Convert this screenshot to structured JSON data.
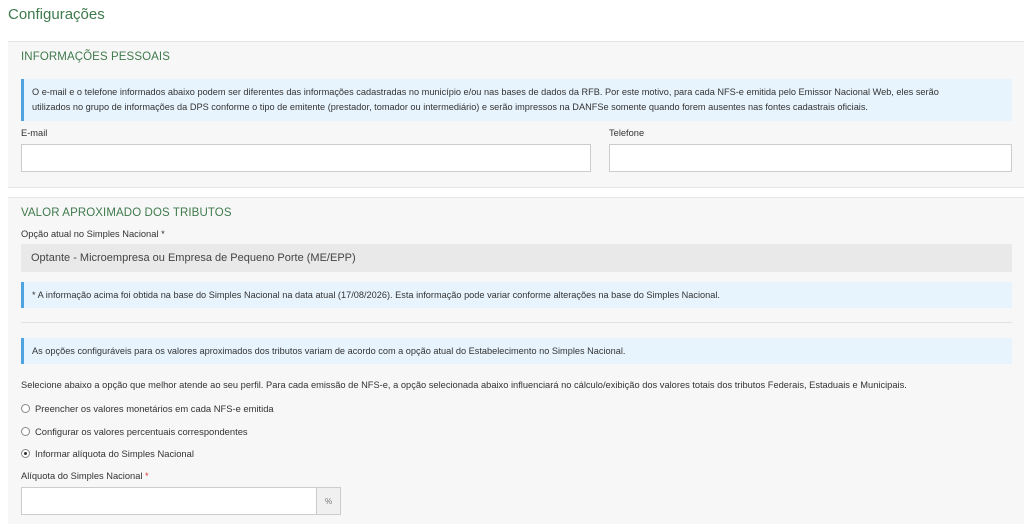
{
  "page": {
    "title": "Configurações"
  },
  "personal_info": {
    "title": "INFORMAÇÕES PESSOAIS",
    "notice_line1": "O e-mail e o telefone informados abaixo podem ser diferentes das informações cadastradas no município e/ou nas bases de dados da RFB. Por este motivo, para cada NFS-e emitida pelo Emissor Nacional Web, eles serão",
    "notice_line2": "utilizados no grupo de informações da DPS conforme o tipo de emitente (prestador, tomador ou intermediário) e serão impressos na DANFSe somente quando forem ausentes nas fontes cadastrais oficiais.",
    "email_label": "E-mail",
    "email_value": "",
    "phone_label": "Telefone",
    "phone_value": ""
  },
  "taxes": {
    "title": "VALOR APROXIMADO DOS TRIBUTOS",
    "simples_label": "Opção atual no Simples Nacional",
    "required_mark": "*",
    "simples_value": "Optante - Microempresa ou Empresa de Pequeno Porte (ME/EPP)",
    "simples_notice": "* A informação acima foi obtida na base do Simples Nacional na data atual (17/08/2026). Esta informação pode variar conforme alterações na base do Simples Nacional.",
    "options_notice": "As opções configuráveis para os valores aproximados dos tributos variam de acordo com a opção atual do Estabelecimento no Simples Nacional.",
    "instruction": "Selecione abaixo a opção que melhor atende ao seu perfil. Para cada emissão de NFS-e, a opção selecionada abaixo influenciará no cálculo/exibição dos valores totais dos tributos Federais, Estaduais e Municipais.",
    "options": [
      {
        "label": "Preencher os valores monetários em cada NFS-e emitida",
        "checked": false
      },
      {
        "label": "Configurar os valores percentuais correspondentes",
        "checked": false
      },
      {
        "label": "Informar alíquota do Simples Nacional",
        "checked": true
      }
    ],
    "aliquota_label": "Alíquota do Simples Nacional",
    "aliquota_value": "",
    "percent_symbol": "%"
  }
}
